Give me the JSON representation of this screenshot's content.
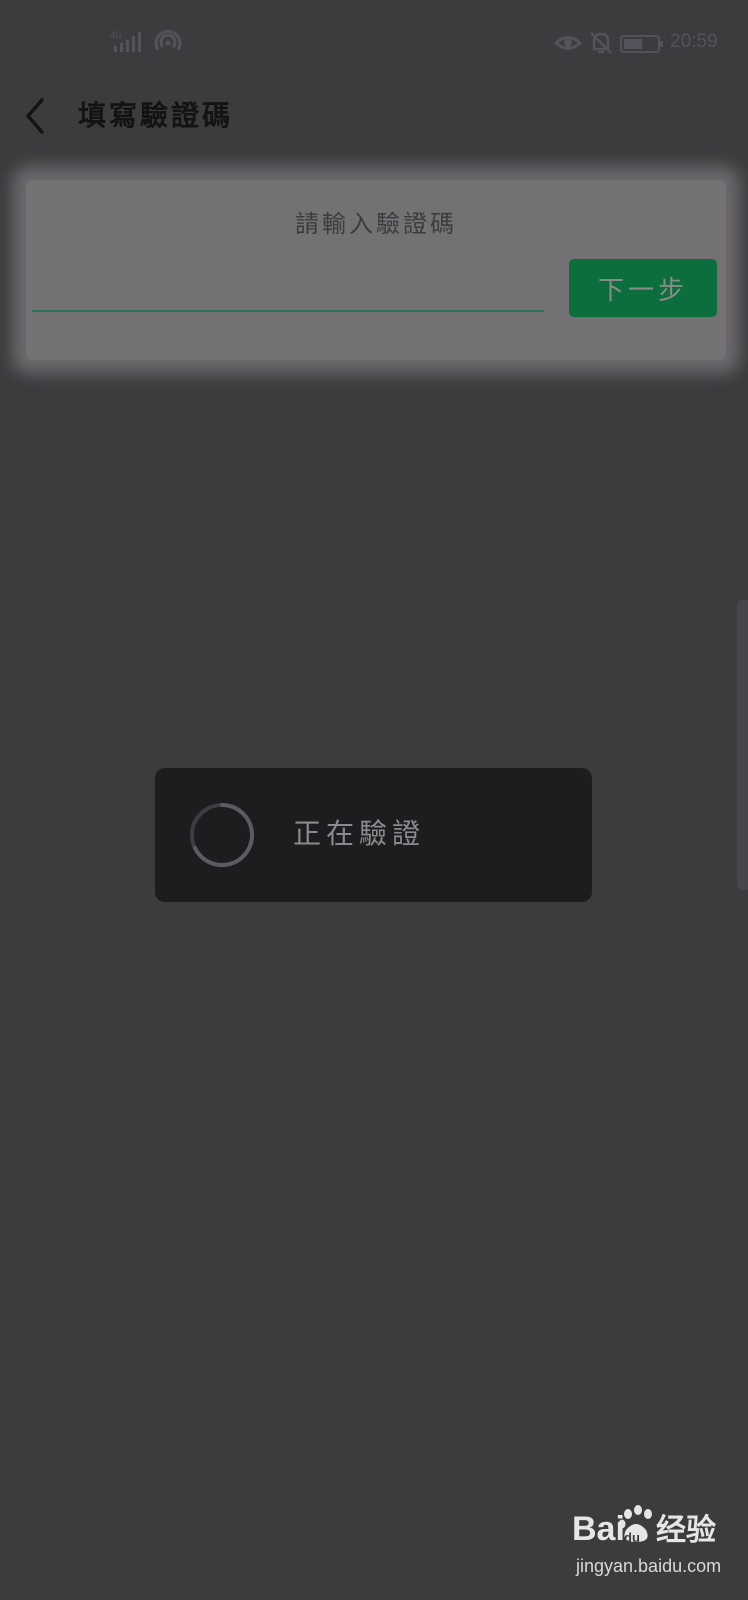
{
  "status_bar": {
    "time": "20:59",
    "signal_icon": "signal-4g-icon",
    "hotspot_icon": "hotspot-icon",
    "eye_icon": "eye-comfort-icon",
    "mute_icon": "bell-off-icon",
    "battery_icon": "battery-icon",
    "color": "#55535a"
  },
  "header": {
    "back_icon": "chevron-left-icon",
    "title": "填寫驗證碼"
  },
  "form": {
    "prompt": "請輸入驗證碼",
    "code_value": "",
    "code_placeholder": "",
    "next_label": "下一步",
    "next_color": "#0d6e3d"
  },
  "toast": {
    "spinner_icon": "loading-spinner-icon",
    "text": "正在驗證"
  },
  "watermark": {
    "brand": "Baidu经验",
    "url": "jingyan.baidu.com"
  },
  "colors": {
    "background": "#3d3b3e",
    "card": "#737174",
    "toast": "#1e1c1f",
    "accent": "#0d6e3d"
  }
}
